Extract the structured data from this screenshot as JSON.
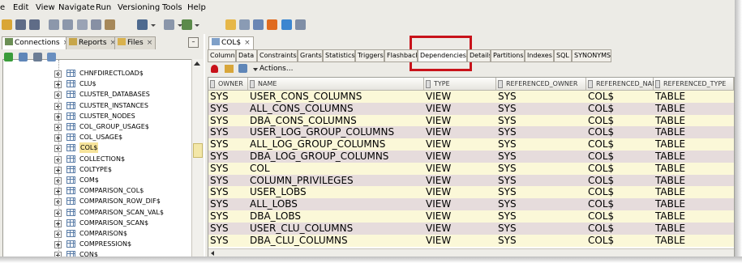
{
  "menu": [
    "e",
    "Edit",
    "View",
    "Navigate",
    "Run",
    "Versioning",
    "Tools",
    "Help"
  ],
  "menu_mnemonic": [
    "",
    "E",
    "V",
    "N",
    "R",
    "n",
    "T",
    "H"
  ],
  "left_tabs": [
    {
      "label": "Connections",
      "close": "×"
    },
    {
      "label": "Reports",
      "close": "×"
    },
    {
      "label": "Files",
      "close": "×"
    }
  ],
  "left_minimize": "–",
  "tree": [
    "CHNFDIRECTLOAD$",
    "CLU$",
    "CLUSTER_DATABASES",
    "CLUSTER_INSTANCES",
    "CLUSTER_NODES",
    "COL_GROUP_USAGE$",
    "COL_USAGE$",
    "COL$",
    "COLLECTION$",
    "COLTYPE$",
    "COM$",
    "COMPARISON_COL$",
    "COMPARISON_ROW_DIF$",
    "COMPARISON_SCAN_VAL$",
    "COMPARISON_SCAN$",
    "COMPARISON$",
    "COMPRESSION$",
    "CON$"
  ],
  "editor_tab": {
    "label": "COL$",
    "close": "×"
  },
  "subtabs": [
    "Columns",
    "Data",
    "Constraints",
    "Grants",
    "Statistics",
    "Triggers",
    "Flashback",
    "Dependencies",
    "Details",
    "Partitions",
    "Indexes",
    "SQL",
    "SYNONYMS"
  ],
  "actions_label": "Actions...",
  "columns": [
    "OWNER",
    "NAME",
    "TYPE",
    "REFERENCED_OWNER",
    "REFERENCED_NAME",
    "REFERENCED_TYPE"
  ],
  "rows": [
    [
      "SYS",
      "USER_CONS_COLUMNS",
      "VIEW",
      "SYS",
      "COL$",
      "TABLE"
    ],
    [
      "SYS",
      "ALL_CONS_COLUMNS",
      "VIEW",
      "SYS",
      "COL$",
      "TABLE"
    ],
    [
      "SYS",
      "DBA_CONS_COLUMNS",
      "VIEW",
      "SYS",
      "COL$",
      "TABLE"
    ],
    [
      "SYS",
      "USER_LOG_GROUP_COLUMNS",
      "VIEW",
      "SYS",
      "COL$",
      "TABLE"
    ],
    [
      "SYS",
      "ALL_LOG_GROUP_COLUMNS",
      "VIEW",
      "SYS",
      "COL$",
      "TABLE"
    ],
    [
      "SYS",
      "DBA_LOG_GROUP_COLUMNS",
      "VIEW",
      "SYS",
      "COL$",
      "TABLE"
    ],
    [
      "SYS",
      "COL",
      "VIEW",
      "SYS",
      "COL$",
      "TABLE"
    ],
    [
      "SYS",
      "COLUMN_PRIVILEGES",
      "VIEW",
      "SYS",
      "COL$",
      "TABLE"
    ],
    [
      "SYS",
      "USER_LOBS",
      "VIEW",
      "SYS",
      "COL$",
      "TABLE"
    ],
    [
      "SYS",
      "ALL_LOBS",
      "VIEW",
      "SYS",
      "COL$",
      "TABLE"
    ],
    [
      "SYS",
      "DBA_LOBS",
      "VIEW",
      "SYS",
      "COL$",
      "TABLE"
    ],
    [
      "SYS",
      "USER_CLU_COLUMNS",
      "VIEW",
      "SYS",
      "COL$",
      "TABLE"
    ],
    [
      "SYS",
      "DBA_CLU_COLUMNS",
      "VIEW",
      "SYS",
      "COL$",
      "TABLE"
    ]
  ],
  "colors": {
    "row_yellow": "#fbf8d8",
    "row_pink": "#e6dcdc",
    "highlight": "#c8121a",
    "selected_tree": "#f6e39a"
  }
}
